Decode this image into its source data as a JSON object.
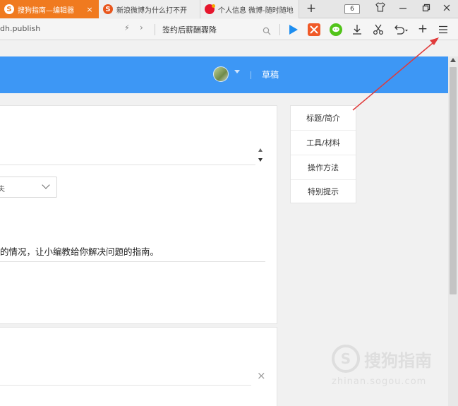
{
  "tabs": [
    {
      "title": "搜狗指南—编辑器",
      "close": "×",
      "icon": "sogou-s-icon"
    },
    {
      "title": "新浪微博为什么打不开",
      "icon": "sogou-s-icon"
    },
    {
      "title": "个人信息 微博-随时随地",
      "icon": "weibo-icon"
    }
  ],
  "tab_bar": {
    "new_tab": "+",
    "tab_count": "6"
  },
  "toolbar": {
    "url": "dh.publish",
    "search_text": "签约后薪酬骤降",
    "new": "+"
  },
  "header": {
    "draft_label": "草稿"
  },
  "editor": {
    "select_value": "夫",
    "description": "的情况，让小编教给你解决问题的指南。",
    "clear": "×"
  },
  "side_nav": {
    "items": [
      {
        "label": "标题/简介"
      },
      {
        "label": "工具/材料"
      },
      {
        "label": "操作方法"
      },
      {
        "label": "特别提示"
      }
    ]
  },
  "watermark": {
    "text": "搜狗指南",
    "sub": "zhinan.sogou.com"
  },
  "colors": {
    "accent_tab": "#f07a1f",
    "header_blue": "#3d97f5",
    "annotation_red": "#e03a3a"
  }
}
